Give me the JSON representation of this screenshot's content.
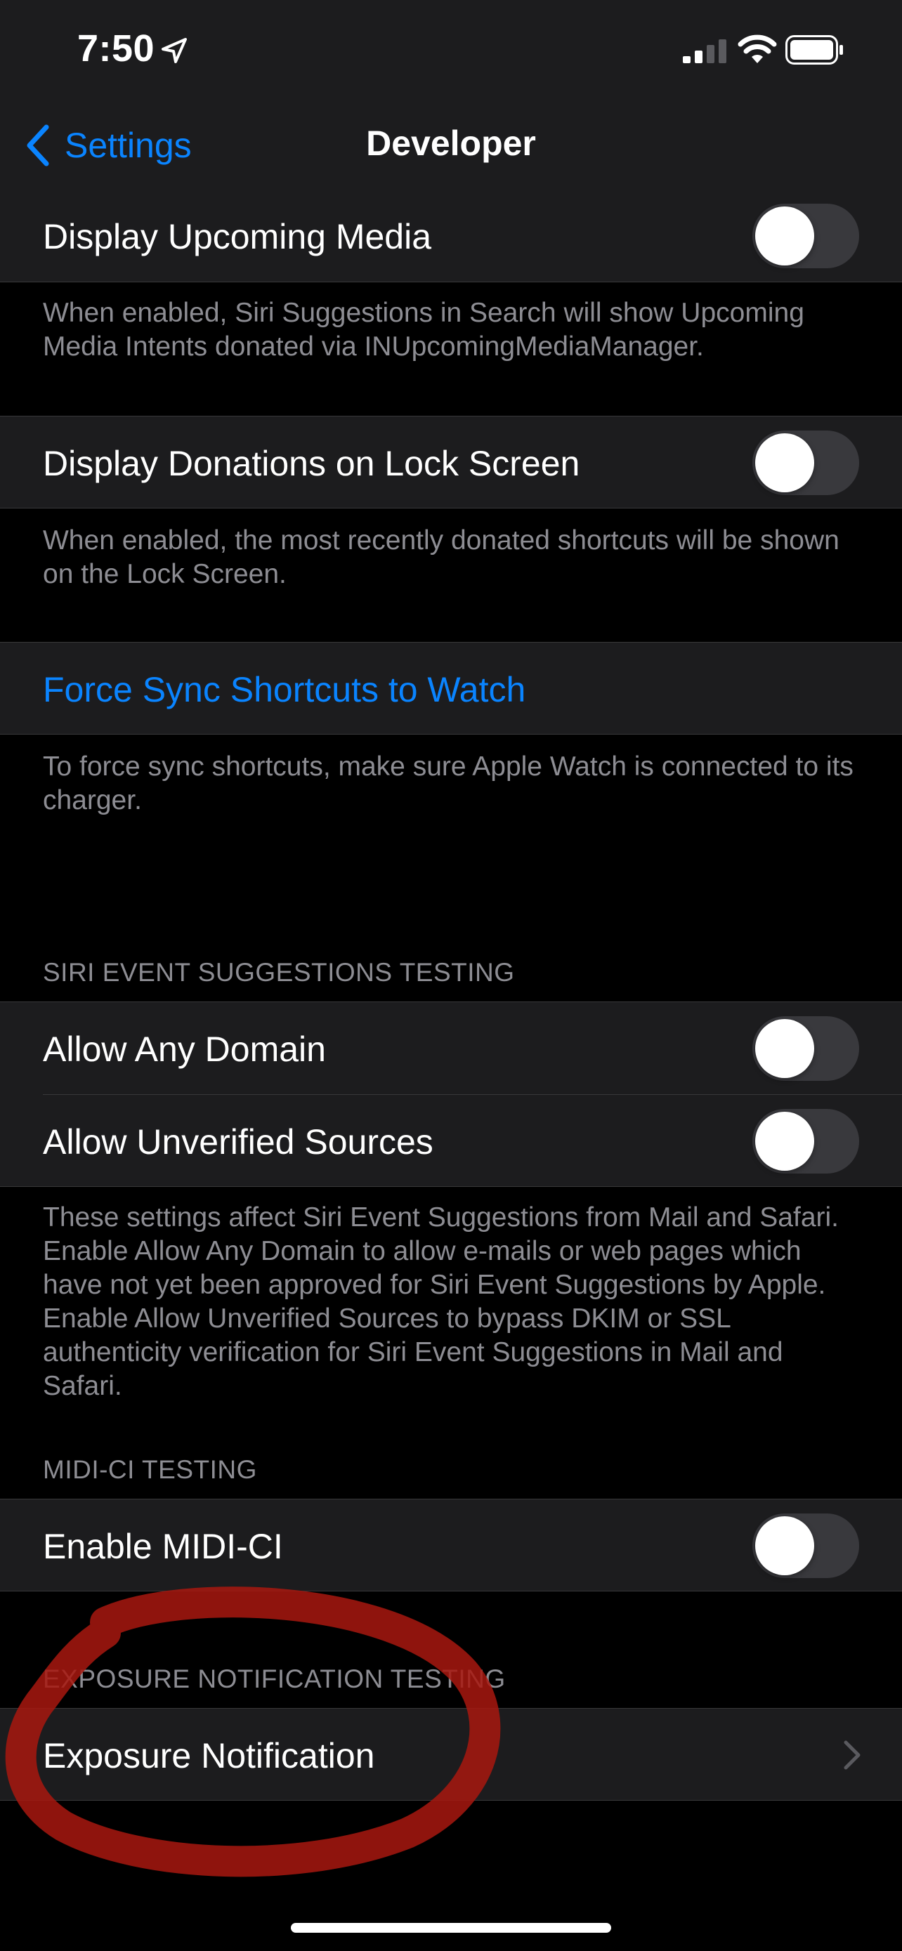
{
  "status_bar": {
    "time": "7:50"
  },
  "nav": {
    "back_label": "Settings",
    "title": "Developer"
  },
  "rows": {
    "display_upcoming_media": {
      "label": "Display Upcoming Media",
      "toggle_on": false
    },
    "display_donations": {
      "label": "Display Donations on Lock Screen",
      "toggle_on": false
    },
    "force_sync": {
      "label": "Force Sync Shortcuts to Watch"
    },
    "allow_any_domain": {
      "label": "Allow Any Domain",
      "toggle_on": false
    },
    "allow_unverified": {
      "label": "Allow Unverified Sources",
      "toggle_on": false
    },
    "enable_midi": {
      "label": "Enable MIDI-CI",
      "toggle_on": false
    },
    "exposure_notification": {
      "label": "Exposure Notification"
    }
  },
  "footers": {
    "upcoming_media": "When enabled, Siri Suggestions in Search will show Upcoming Media Intents donated via INUpcomingMediaManager.",
    "donations": "When enabled, the most recently donated shortcuts will be shown on the Lock Screen.",
    "force_sync": "To force sync shortcuts, make sure Apple Watch is connected to its charger.",
    "siri_event": "These settings affect Siri Event Suggestions from Mail and Safari. Enable Allow Any Domain to allow e-mails or web pages which have not yet been approved for Siri Event Suggestions by Apple. Enable Allow Unverified Sources to bypass DKIM or SSL authenticity verification for Siri Event Suggestions in Mail and Safari."
  },
  "section_headers": {
    "siri_event": "SIRI EVENT SUGGESTIONS TESTING",
    "midi": "MIDI-CI TESTING",
    "exposure": "EXPOSURE NOTIFICATION TESTING"
  },
  "icons": [
    "location-arrow-icon",
    "signal-icon",
    "wifi-icon",
    "battery-icon",
    "chevron-left-icon",
    "chevron-right-icon"
  ],
  "colors": {
    "accent": "#0a84ff",
    "annotation": "#c0281c",
    "cell_bg": "#1c1c1e",
    "secondary_text": "#8d8d93"
  }
}
